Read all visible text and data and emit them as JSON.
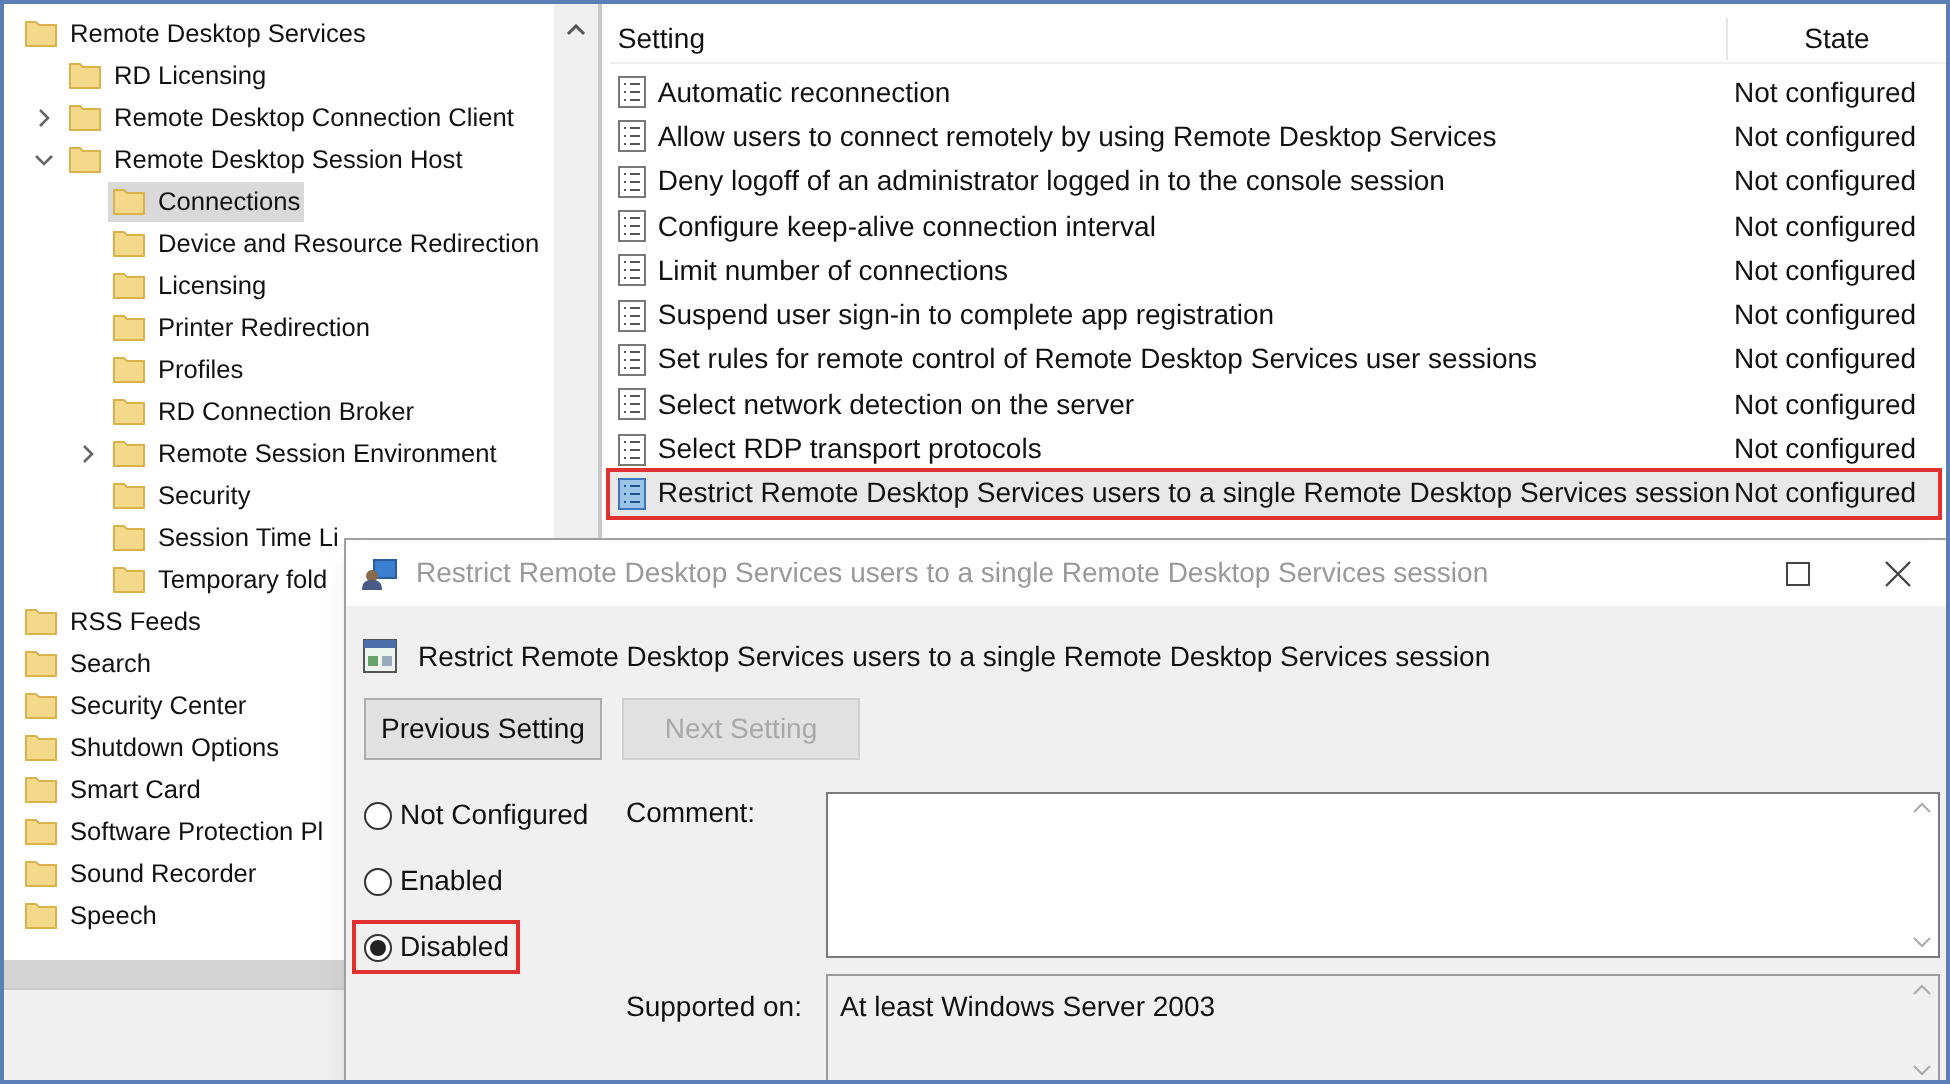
{
  "tree": {
    "items": [
      {
        "label": "Remote Desktop Services",
        "selected": false,
        "children": [
          {
            "label": "RD Licensing",
            "selected": false
          },
          {
            "label": "Remote Desktop Connection Client",
            "selected": false,
            "expanded": false
          },
          {
            "label": "Remote Desktop Session Host",
            "selected": false,
            "expanded": true,
            "children": [
              {
                "label": "Connections",
                "selected": true
              },
              {
                "label": "Device and Resource Redirection",
                "selected": false
              },
              {
                "label": "Licensing",
                "selected": false
              },
              {
                "label": "Printer Redirection",
                "selected": false
              },
              {
                "label": "Profiles",
                "selected": false
              },
              {
                "label": "RD Connection Broker",
                "selected": false
              },
              {
                "label": "Remote Session Environment",
                "selected": false,
                "expanded": false
              },
              {
                "label": "Security",
                "selected": false
              },
              {
                "label": "Session Time Li",
                "selected": false
              },
              {
                "label": "Temporary fold",
                "selected": false
              }
            ]
          }
        ]
      },
      {
        "label": "RSS Feeds",
        "selected": false
      },
      {
        "label": "Search",
        "selected": false
      },
      {
        "label": "Security Center",
        "selected": false
      },
      {
        "label": "Shutdown Options",
        "selected": false
      },
      {
        "label": "Smart Card",
        "selected": false
      },
      {
        "label": "Software Protection Pl",
        "selected": false
      },
      {
        "label": "Sound Recorder",
        "selected": false
      },
      {
        "label": "Speech",
        "selected": false
      }
    ]
  },
  "settings_list": {
    "columns": [
      "Setting",
      "State"
    ],
    "rows": [
      {
        "setting": "Automatic reconnection",
        "state": "Not configured",
        "selected": false,
        "highlighted": false
      },
      {
        "setting": "Allow users to connect remotely by using Remote Desktop Services",
        "state": "Not configured",
        "selected": false,
        "highlighted": false
      },
      {
        "setting": "Deny logoff of an administrator logged in to the console session",
        "state": "Not configured",
        "selected": false,
        "highlighted": false
      },
      {
        "setting": "Configure keep-alive connection interval",
        "state": "Not configured",
        "selected": false,
        "highlighted": false
      },
      {
        "setting": "Limit number of connections",
        "state": "Not configured",
        "selected": false,
        "highlighted": false
      },
      {
        "setting": "Suspend user sign-in to complete app registration",
        "state": "Not configured",
        "selected": false,
        "highlighted": false
      },
      {
        "setting": "Set rules for remote control of Remote Desktop Services user sessions",
        "state": "Not configured",
        "selected": false,
        "highlighted": false
      },
      {
        "setting": "Select network detection on the server",
        "state": "Not configured",
        "selected": false,
        "highlighted": false
      },
      {
        "setting": "Select RDP transport protocols",
        "state": "Not configured",
        "selected": false,
        "highlighted": false
      },
      {
        "setting": "Restrict Remote Desktop Services users to a single Remote Desktop Services session",
        "state": "Not configured",
        "selected": true,
        "highlighted": true
      }
    ]
  },
  "dialog": {
    "title": "Restrict Remote Desktop Services users to a single Remote Desktop Services session",
    "policy_name": "Restrict Remote Desktop Services users to a single Remote Desktop Services session",
    "buttons": [
      {
        "label": "Previous Setting",
        "disabled": false
      },
      {
        "label": "Next Setting",
        "disabled": true
      }
    ],
    "options": [
      {
        "label": "Not Configured",
        "selected": false,
        "highlighted": false
      },
      {
        "label": "Enabled",
        "selected": false,
        "highlighted": false
      },
      {
        "label": "Disabled",
        "selected": true,
        "highlighted": true
      }
    ],
    "comment": {
      "label": "Comment:"
    },
    "supported_on": {
      "label": "Supported on:",
      "value": "At least Windows Server 2003"
    }
  }
}
